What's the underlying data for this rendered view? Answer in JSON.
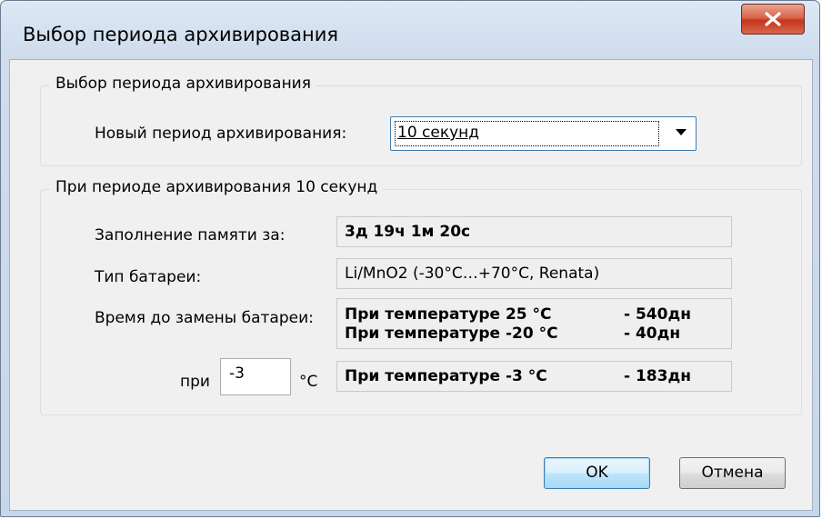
{
  "window": {
    "title": "Выбор периода архивирования"
  },
  "group_period": {
    "legend": "Выбор периода архивирования",
    "new_period_label": "Новый период архивирования:",
    "period_select": {
      "selected": "10 секунд"
    }
  },
  "group_info": {
    "legend": "При периоде архивирования 10 секунд",
    "memory_label": "Заполнение памяти за:",
    "memory_value": "3д 19ч 1м 20с",
    "battery_type_label": "Тип батареи:",
    "battery_type_value": "Li/MnO2 (-30°C…+70°C, Renata)",
    "battery_time_label": "Время до замены батареи:",
    "battery_rows": [
      {
        "label": "При температуре 25 °C",
        "days": "- 540дн"
      },
      {
        "label": "При температуре -20 °C",
        "days": "- 40дн"
      }
    ],
    "at_label": "при",
    "temp_input_value": "-3",
    "temp_unit": "°C",
    "custom_row": {
      "label": "При температуре -3 °C",
      "days": "- 183дн"
    }
  },
  "buttons": {
    "ok": "OK",
    "cancel": "Отмена"
  },
  "colors": {
    "close_button": "#c2351b",
    "default_button_border": "#3c7fb1"
  },
  "icons": {
    "close": "close-x-icon",
    "dropdown": "chevron-down-icon"
  }
}
